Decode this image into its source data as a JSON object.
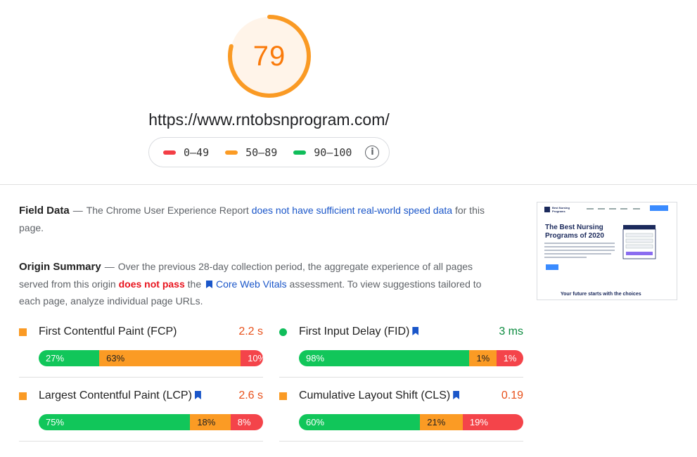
{
  "score": {
    "value": "79",
    "fraction": 0.79,
    "color": "#fa7a0a"
  },
  "url": "https://www.rntobsnprogram.com/",
  "legend": {
    "items": [
      {
        "label": "0–49",
        "color": "#f33e45"
      },
      {
        "label": "50–89",
        "color": "#fb9b24"
      },
      {
        "label": "90–100",
        "color": "#0fbd5a"
      }
    ],
    "info_icon": "info-icon"
  },
  "field_data": {
    "title": "Field Data",
    "text_before": "The Chrome User Experience Report",
    "link": "does not have sufficient real-world speed data",
    "text_after": "for this page."
  },
  "origin_summary": {
    "title": "Origin Summary",
    "text_1": "Over the previous 28-day collection period, the aggregate experience of all pages served from this origin",
    "fail_text": "does not pass",
    "text_2": "the",
    "cwv_link": "Core Web Vitals",
    "text_3": "assessment. To view suggestions tailored to each page, analyze individual page URLs."
  },
  "metrics": [
    {
      "name": "First Contentful Paint (FCP)",
      "value": "2.2 s",
      "value_color": "#e8501a",
      "marker": "square",
      "cwv": false,
      "segments": [
        {
          "label": "27%",
          "fraction": 0.27,
          "type": "good"
        },
        {
          "label": "63%",
          "fraction": 0.63,
          "type": "avg"
        },
        {
          "label": "10%",
          "fraction": 0.1,
          "type": "poor"
        }
      ]
    },
    {
      "name": "First Input Delay (FID)",
      "value": "3 ms",
      "value_color": "#0a8a3e",
      "marker": "circle",
      "cwv": true,
      "segments": [
        {
          "label": "98%",
          "fraction": 0.76,
          "type": "good"
        },
        {
          "label": "1%",
          "fraction": 0.12,
          "type": "avg"
        },
        {
          "label": "1%",
          "fraction": 0.12,
          "type": "poor"
        }
      ]
    },
    {
      "name": "Largest Contentful Paint (LCP)",
      "value": "2.6 s",
      "value_color": "#e8501a",
      "marker": "square",
      "cwv": true,
      "segments": [
        {
          "label": "75%",
          "fraction": 0.675,
          "type": "good"
        },
        {
          "label": "18%",
          "fraction": 0.18,
          "type": "avg"
        },
        {
          "label": "8%",
          "fraction": 0.145,
          "type": "poor"
        }
      ]
    },
    {
      "name": "Cumulative Layout Shift (CLS)",
      "value": "0.19",
      "value_color": "#e8501a",
      "marker": "square",
      "cwv": true,
      "segments": [
        {
          "label": "60%",
          "fraction": 0.54,
          "type": "good"
        },
        {
          "label": "21%",
          "fraction": 0.19,
          "type": "avg"
        },
        {
          "label": "19%",
          "fraction": 0.27,
          "type": "poor"
        }
      ]
    }
  ],
  "thumbnail": {
    "logo": "Best Nursing Programs",
    "headline": "The Best Nursing Programs of 2020",
    "sub": "Your future starts with the choices"
  }
}
